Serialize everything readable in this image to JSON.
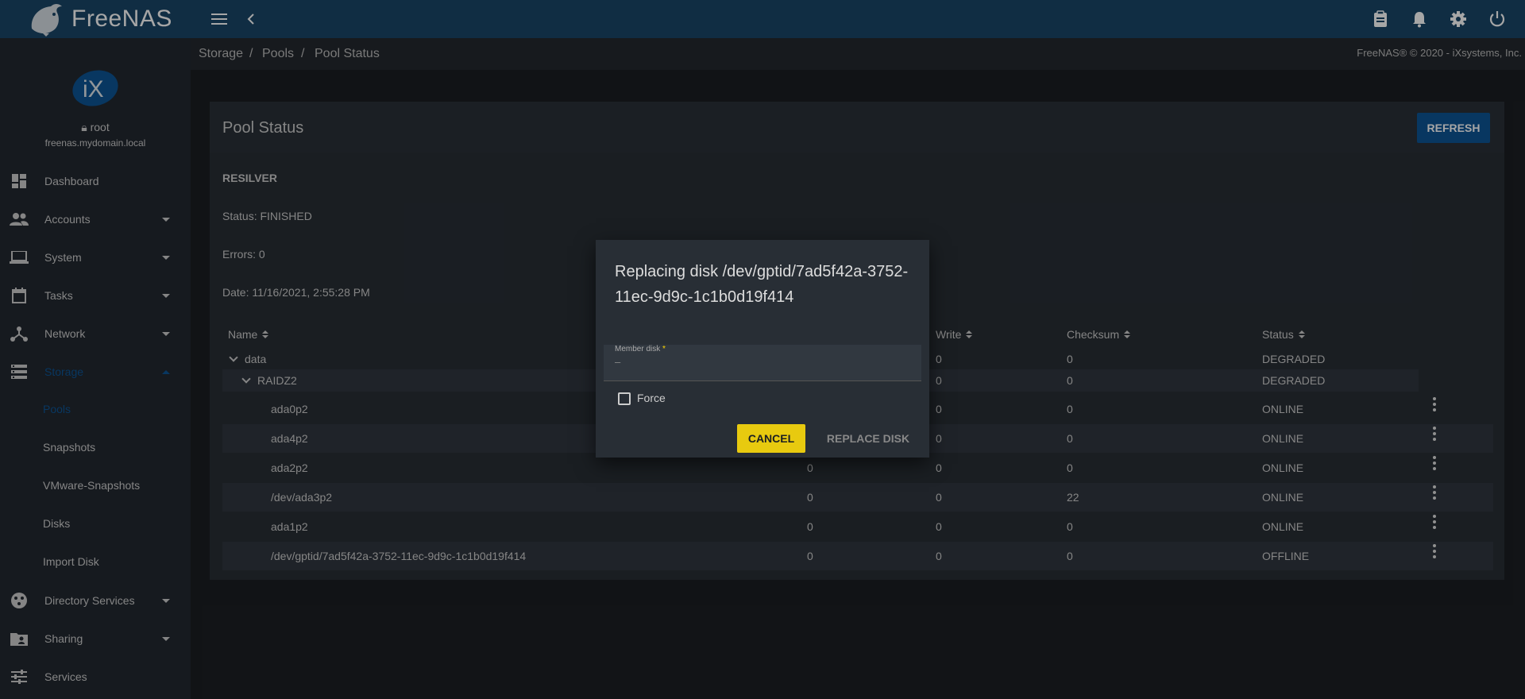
{
  "app": {
    "brand": "FreeNAS",
    "copyright": "FreeNAS® © 2020 - iXsystems, Inc."
  },
  "topbar": {
    "icons": [
      "menu-icon",
      "back-arrow-icon",
      "clipboard-icon",
      "bell-icon",
      "gear-icon",
      "power-icon"
    ]
  },
  "user": {
    "name": "root",
    "host": "freenas.mydomain.local"
  },
  "nav": [
    {
      "label": "Dashboard",
      "icon": "dashboard-icon"
    },
    {
      "label": "Accounts",
      "icon": "accounts-icon"
    },
    {
      "label": "System",
      "icon": "laptop-icon"
    },
    {
      "label": "Tasks",
      "icon": "calendar-icon"
    },
    {
      "label": "Network",
      "icon": "network-icon"
    },
    {
      "label": "Storage",
      "icon": "storage-icon"
    },
    {
      "label": "Directory Services",
      "icon": "directory-icon"
    },
    {
      "label": "Sharing",
      "icon": "folder-share-icon"
    },
    {
      "label": "Services",
      "icon": "tune-icon"
    }
  ],
  "storage_sub": [
    "Pools",
    "Snapshots",
    "VMware-Snapshots",
    "Disks",
    "Import Disk"
  ],
  "breadcrumb": [
    "Storage",
    "/",
    "Pools",
    "/",
    "Pool Status"
  ],
  "card": {
    "title": "Pool Status",
    "refresh_label": "REFRESH",
    "resilver_label": "RESILVER",
    "status": "Status: FINISHED",
    "errors": "Errors: 0",
    "date": "Date: 11/16/2021, 2:55:28 PM"
  },
  "table": {
    "headers": {
      "name": "Name",
      "write": "Write",
      "checksum": "Checksum",
      "status": "Status"
    },
    "rows": [
      {
        "name": "data",
        "read": "",
        "write": "0",
        "checksum": "0",
        "status": "DEGRADED"
      },
      {
        "name": "RAIDZ2",
        "read": "",
        "write": "0",
        "checksum": "0",
        "status": "DEGRADED"
      },
      {
        "name": "ada0p2",
        "read": "",
        "write": "0",
        "checksum": "0",
        "status": "ONLINE"
      },
      {
        "name": "ada4p2",
        "read": "",
        "write": "0",
        "checksum": "0",
        "status": "ONLINE"
      },
      {
        "name": "ada2p2",
        "read": "0",
        "write": "0",
        "checksum": "0",
        "status": "ONLINE"
      },
      {
        "name": "/dev/ada3p2",
        "read": "0",
        "write": "0",
        "checksum": "22",
        "status": "ONLINE"
      },
      {
        "name": "ada1p2",
        "read": "0",
        "write": "0",
        "checksum": "0",
        "status": "ONLINE"
      },
      {
        "name": "/dev/gptid/7ad5f42a-3752-11ec-9d9c-1c1b0d19f414",
        "read": "0",
        "write": "0",
        "checksum": "0",
        "status": "OFFLINE"
      }
    ]
  },
  "dialog": {
    "title": "Replacing disk /dev/gptid/7ad5f42a-3752-11ec-9d9c-1c1b0d19f414",
    "member_label": "Member disk",
    "member_required": "*",
    "member_value": "–",
    "force_label": "Force",
    "cancel_label": "CANCEL",
    "replace_label": "REPLACE DISK"
  }
}
